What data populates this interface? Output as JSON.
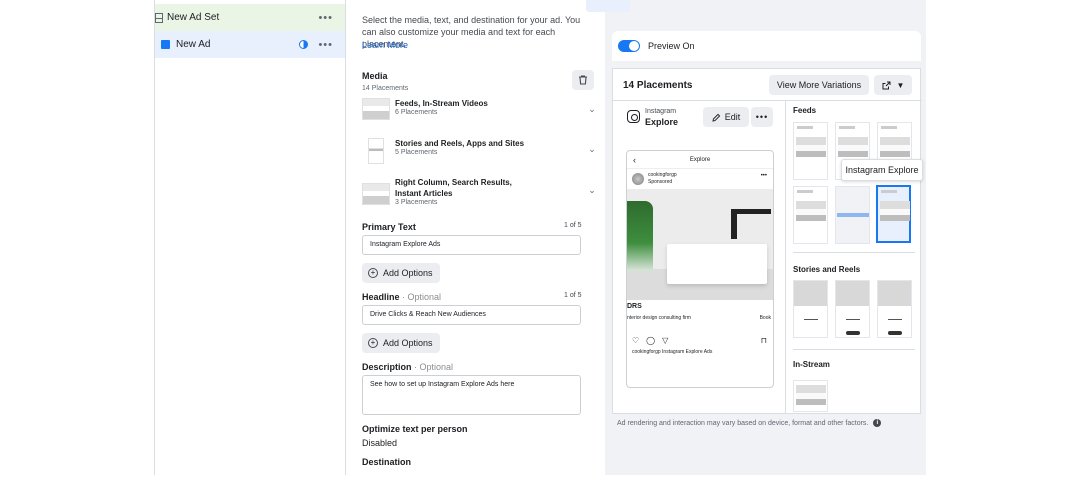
{
  "tree": {
    "adset_label": "New Ad Set",
    "ad_label": "New Ad",
    "more": "•••"
  },
  "form": {
    "intro": "Select the media, text, and destination for your ad. You can also customize your media and text for each placement.",
    "learn_more": "Learn More",
    "media": {
      "title": "Media",
      "subtitle": "14 Placements",
      "groups": [
        {
          "name": "Feeds, In-Stream Videos",
          "count": "6 Placements"
        },
        {
          "name": "Stories and Reels, Apps and Sites",
          "count": "5 Placements"
        },
        {
          "name": "Right Column, Search Results, Instant Articles",
          "count": "3 Placements"
        }
      ]
    },
    "primary_text": {
      "label": "Primary Text",
      "count": "1 of 5",
      "value": "Instagram Explore Ads"
    },
    "headline": {
      "label": "Headline",
      "optional": " · Optional",
      "count": "1 of 5",
      "value": "Drive Clicks & Reach New Audiences"
    },
    "description": {
      "label": "Description",
      "optional": " · Optional",
      "value": "See how to set up Instagram Explore Ads here"
    },
    "add_options": "Add Options",
    "optimize": {
      "label": "Optimize text per person",
      "value": "Disabled"
    },
    "destination": {
      "label": "Destination"
    }
  },
  "preview": {
    "toggle_label": "Preview On",
    "placements_title": "14 Placements",
    "view_more": "View More Variations",
    "platform": "Instagram",
    "placement": "Explore",
    "edit": "Edit",
    "more": "•••",
    "phone": {
      "header": "Explore",
      "username": "cookingforgp",
      "sponsored": "Sponsored",
      "ad_title": "DRS",
      "ad_desc": "nterior design consulting firm",
      "cta": "Book",
      "caption": "cookingforgp Instagram Explore Ads"
    },
    "sections": {
      "feeds": "Feeds",
      "stories": "Stories and Reels",
      "instream": "In-Stream"
    },
    "tooltip": "Instagram Explore",
    "footnote": "Ad rendering and interaction may vary based on device, format and other factors."
  }
}
